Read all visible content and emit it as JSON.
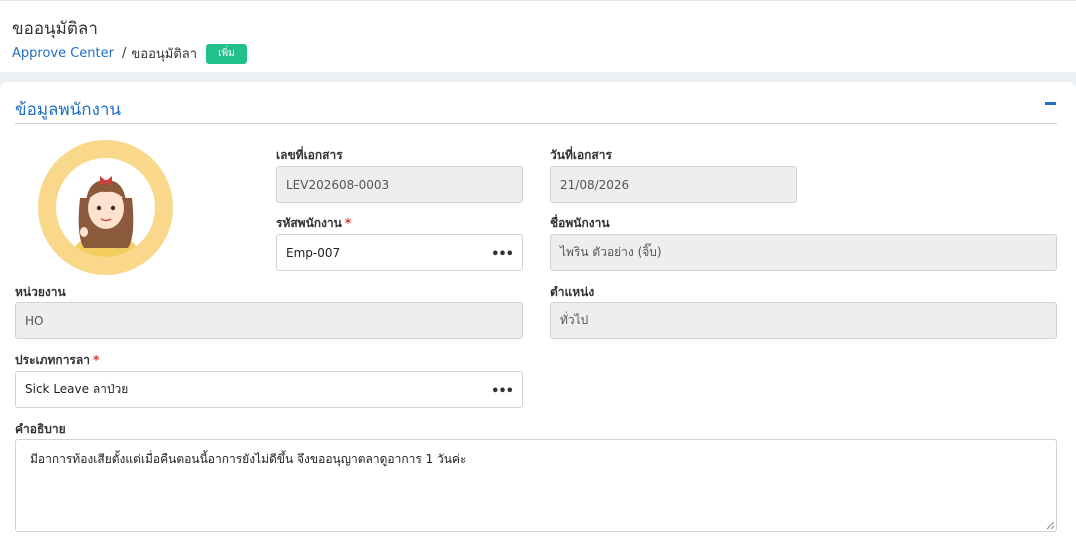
{
  "header": {
    "title": "ขออนุมัติลา",
    "breadcrumb": {
      "link": "Approve Center",
      "separator": "/",
      "current": "ขออนุมัติลา"
    },
    "badge": "เพิ่ม"
  },
  "section": {
    "title": "ข้อมูลพนักงาน"
  },
  "form": {
    "doc_no": {
      "label": "เลขที่เอกสาร",
      "value": "LEV202608-0003"
    },
    "doc_date": {
      "label": "วันที่เอกสาร",
      "value": "21/08/2026"
    },
    "emp_code": {
      "label": "รหัสพนักงาน",
      "required": "*",
      "value": "Emp-007",
      "button": "•••"
    },
    "emp_name": {
      "label": "ชื่อพนักงาน",
      "value": "ไพริน ตัวอย่าง (จิ๊บ)"
    },
    "department": {
      "label": "หน่วยงาน",
      "value": "HO"
    },
    "position": {
      "label": "ตำแหน่ง",
      "value": "ทั่วไป"
    },
    "leave_type": {
      "label": "ประเภทการลา",
      "required": "*",
      "value": "Sick Leave ลาป่วย",
      "button": "•••"
    },
    "description": {
      "label": "คำอธิบาย",
      "value": "มีอาการท้องเสียตั้งแต่เมื่อคืนตอนนี้อาการยังไม่ดีขึ้น จึงขออนุญาตลาดูอาการ 1 วันค่ะ"
    }
  },
  "colors": {
    "accent": "#1f6fc4",
    "badge": "#22c08b",
    "avatar_ring": "#f9d88c",
    "required": "#d9342b"
  },
  "icons": {
    "collapse": "minus-icon",
    "lookup": "ellipsis-icon"
  }
}
